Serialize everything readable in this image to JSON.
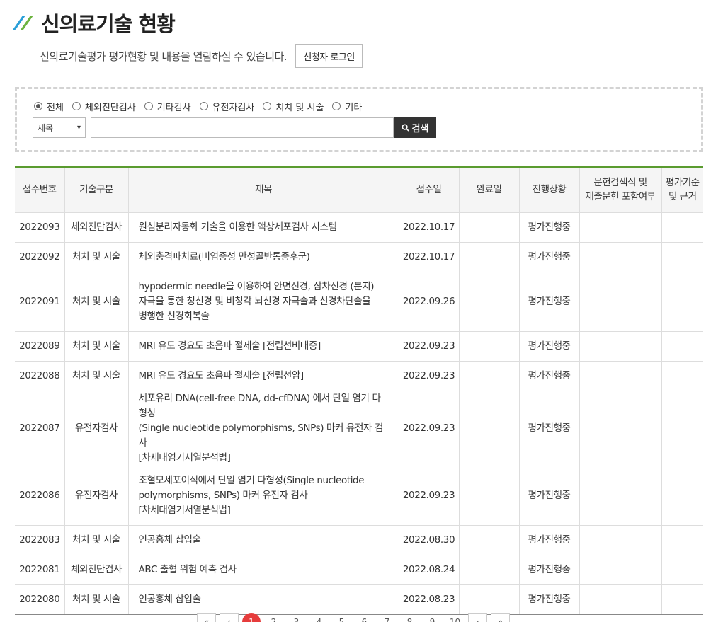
{
  "header": {
    "title": "신의료기술 현황"
  },
  "intro": {
    "description": "신의료기술평가 평가현황 및 내용을 열람하실 수 있습니다.",
    "login_label": "신청자 로그인"
  },
  "search": {
    "radios": [
      {
        "label": "전체",
        "checked": true
      },
      {
        "label": "체외진단검사",
        "checked": false
      },
      {
        "label": "기타검사",
        "checked": false
      },
      {
        "label": "유전자검사",
        "checked": false
      },
      {
        "label": "치치 및 시술",
        "checked": false
      },
      {
        "label": "기타",
        "checked": false
      }
    ],
    "select_value": "제목",
    "input_value": "",
    "button_label": "검색"
  },
  "table": {
    "headers": [
      "접수번호",
      "기술구분",
      "제목",
      "접수일",
      "완료일",
      "진행상황",
      "문헌검색식 및\n제출문헌 포함여부",
      "평가기준\n및 근거"
    ],
    "rows": [
      {
        "id": "2022093",
        "category": "체외진단검사",
        "title": "원심분리자동화 기술을 이용한 액상세포검사 시스템",
        "received": "2022.10.17",
        "completed": "",
        "status": "평가진행중",
        "literature": "",
        "basis": ""
      },
      {
        "id": "2022092",
        "category": "처치 및 시술",
        "title": "체외충격파치료(비염증성 만성골반통증후군)",
        "received": "2022.10.17",
        "completed": "",
        "status": "평가진행중",
        "literature": "",
        "basis": ""
      },
      {
        "id": "2022091",
        "category": "처치 및 시술",
        "title": "hypodermic needle을 이용하여 안면신경, 삼차신경 (분지)\n자극을 통한 청신경 및 비청각 뇌신경 자극술과 신경차단술을\n병행한 신경회복술",
        "received": "2022.09.26",
        "completed": "",
        "status": "평가진행중",
        "literature": "",
        "basis": ""
      },
      {
        "id": "2022089",
        "category": "처치 및 시술",
        "title": "MRI 유도 경요도 초음파 절제술 [전립선비대증]",
        "received": "2022.09.23",
        "completed": "",
        "status": "평가진행중",
        "literature": "",
        "basis": ""
      },
      {
        "id": "2022088",
        "category": "처치 및 시술",
        "title": "MRI 유도 경요도 초음파 절제술 [전립선암]",
        "received": "2022.09.23",
        "completed": "",
        "status": "평가진행중",
        "literature": "",
        "basis": ""
      },
      {
        "id": "2022087",
        "category": "유전자검사",
        "title": "세포유리 DNA(cell-free DNA, dd-cfDNA) 에서 단일 염기 다형성\n(Single nucleotide polymorphisms, SNPs) 마커 유전자 검사\n[차세대염기서열분석법]",
        "received": "2022.09.23",
        "completed": "",
        "status": "평가진행중",
        "literature": "",
        "basis": ""
      },
      {
        "id": "2022086",
        "category": "유전자검사",
        "title": "조혈모세포이식에서 단일 염기 다형성(Single nucleotide\npolymorphisms, SNPs) 마커 유전자 검사\n[차세대염기서열분석법]",
        "received": "2022.09.23",
        "completed": "",
        "status": "평가진행중",
        "literature": "",
        "basis": ""
      },
      {
        "id": "2022083",
        "category": "처치 및 시술",
        "title": "인공홍체 삽입술",
        "received": "2022.08.30",
        "completed": "",
        "status": "평가진행중",
        "literature": "",
        "basis": ""
      },
      {
        "id": "2022081",
        "category": "체외진단검사",
        "title": "ABC 출혈 위험 예측 검사",
        "received": "2022.08.24",
        "completed": "",
        "status": "평가진행중",
        "literature": "",
        "basis": ""
      },
      {
        "id": "2022080",
        "category": "처치 및 시술",
        "title": "인공홍체 삽입술",
        "received": "2022.08.23",
        "completed": "",
        "status": "평가진행중",
        "literature": "",
        "basis": ""
      }
    ]
  },
  "pagination": {
    "first": "«",
    "prev": "‹",
    "pages": [
      "1",
      "2",
      "3",
      "4",
      "5",
      "6",
      "7",
      "8",
      "9",
      "10"
    ],
    "current": "1",
    "next": "›",
    "last": "»"
  }
}
